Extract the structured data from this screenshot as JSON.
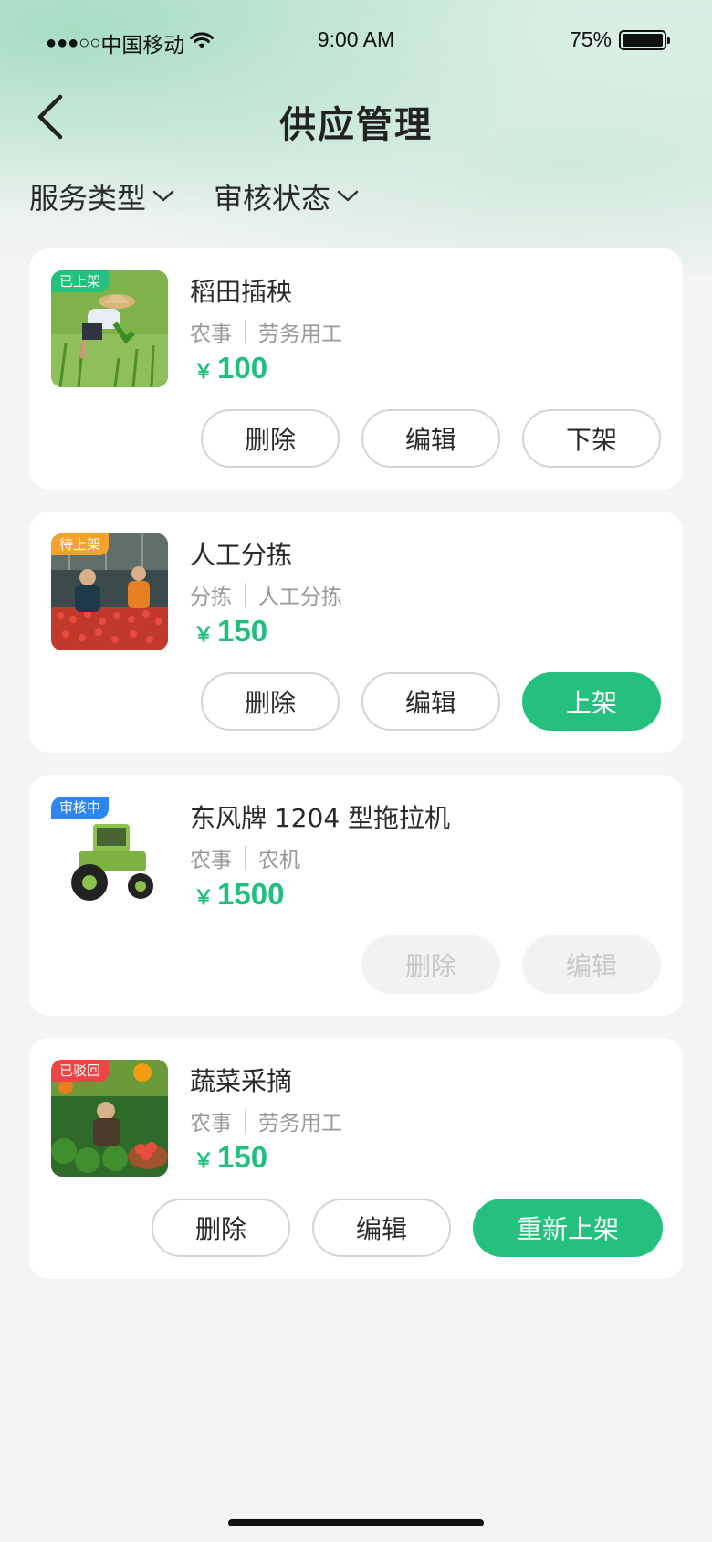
{
  "status_bar": {
    "signal": "●●●○○",
    "carrier": "中国移动",
    "time": "9:00 AM",
    "battery": "75%"
  },
  "nav": {
    "title": "供应管理"
  },
  "filters": [
    {
      "label": "服务类型"
    },
    {
      "label": "审核状态"
    }
  ],
  "colors": {
    "accent": "#23c07e",
    "tag_listed": "#23c07e",
    "tag_pending": "#f5a12e",
    "tag_review": "#2e86f0",
    "tag_rejected": "#ef4444"
  },
  "items": [
    {
      "status": "已上架",
      "title": "稻田插秧",
      "category": "农事",
      "subcategory": "劳务用工",
      "currency": "￥",
      "price": "100",
      "buttons": [
        "删除",
        "编辑",
        "下架"
      ]
    },
    {
      "status": "待上架",
      "title": "人工分拣",
      "category": "分拣",
      "subcategory": "人工分拣",
      "currency": "￥",
      "price": "150",
      "buttons": [
        "删除",
        "编辑",
        "上架"
      ]
    },
    {
      "status": "审核中",
      "title": "东风牌 1204 型拖拉机",
      "category": "农事",
      "subcategory": "农机",
      "currency": "￥",
      "price": "1500",
      "buttons": [
        "删除",
        "编辑"
      ]
    },
    {
      "status": "已驳回",
      "title": "蔬菜采摘",
      "category": "农事",
      "subcategory": "劳务用工",
      "currency": "￥",
      "price": "150",
      "buttons": [
        "删除",
        "编辑",
        "重新上架"
      ]
    }
  ]
}
